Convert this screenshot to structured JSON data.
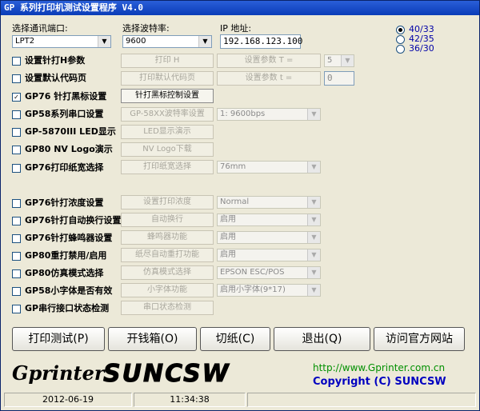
{
  "window": {
    "title": "GP 系列打印机测试设置程序 V4.0"
  },
  "port": {
    "label": "选择通讯端口:",
    "value": "LPT2"
  },
  "baud": {
    "label": "选择波特率:",
    "value": "9600"
  },
  "ip": {
    "label": "IP 地址:",
    "value": "192.168.123.100"
  },
  "radios": [
    "40/33",
    "42/35",
    "36/30"
  ],
  "rows": {
    "r1": {
      "checkbox": "设置针打H参数",
      "btn1": "打印 H",
      "btn2": "设置参数  T =",
      "combo": "5"
    },
    "r2": {
      "checkbox": "设置默认代码页",
      "btn1": "打印默认代码页",
      "btn2": "设置参数  t =",
      "input": "0"
    },
    "r3": {
      "checkbox": "GP76 针打黑标设置",
      "mark": "✓",
      "btn1": "针打黑标控制设置"
    },
    "r4": {
      "checkbox": "GP58系列串口设置",
      "btn1": "GP-58XX波特率设置",
      "combo": "1: 9600bps"
    },
    "r5": {
      "checkbox": "GP-5870III LED显示",
      "btn1": "LED显示演示"
    },
    "r6": {
      "checkbox": "GP80 NV Logo演示",
      "btn1": "NV Logo下载"
    },
    "r7": {
      "checkbox": "GP76打印纸宽选择",
      "btn1": "打印纸宽选择",
      "combo": "76mm"
    },
    "r8": {
      "checkbox": "GP76针打浓度设置",
      "btn1": "设置打印浓度",
      "combo": "Normal"
    },
    "r9": {
      "checkbox": "GP76针打自动换行设置",
      "btn1": "自动换行",
      "combo": "启用"
    },
    "r10": {
      "checkbox": "GP76针打蜂鸣器设置",
      "btn1": "蜂鸣器功能",
      "combo": "启用"
    },
    "r11": {
      "checkbox": "GP80重打禁用/启用",
      "btn1": "纸尽自动重打功能",
      "combo": "启用"
    },
    "r12": {
      "checkbox": "GP80仿真模式选择",
      "btn1": "仿真模式选择",
      "combo": "EPSON ESC/POS"
    },
    "r13": {
      "checkbox": "GP58小字体是否有效",
      "btn1": "小字体功能",
      "combo": "启用小字体(9*17)"
    },
    "r14": {
      "checkbox": "GP串行接口状态检测",
      "btn1": "串口状态检测"
    }
  },
  "actions": {
    "print_test": "打印测试(P)",
    "cash_drawer": "开钱箱(O)",
    "cut_paper": "切纸(C)",
    "exit": "退出(Q)",
    "website": "访问官方网站"
  },
  "logo": {
    "text": "GprinterSUNCSW"
  },
  "footer": {
    "url": "http://www.Gprinter.com.cn",
    "copyright": "Copyright (C) SUNCSW"
  },
  "status": {
    "date": "2012-06-19",
    "time": "11:34:38"
  }
}
